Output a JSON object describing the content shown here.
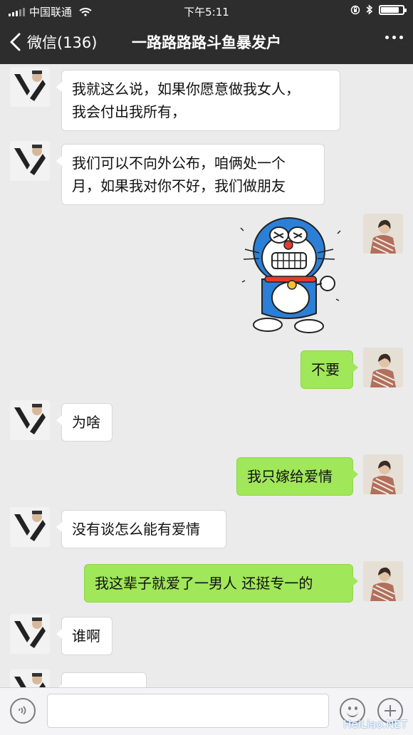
{
  "status_bar": {
    "carrier": "中国联通",
    "time": "下午5:11",
    "battery_level": 0.85
  },
  "nav": {
    "back_label": "微信(136)",
    "title": "一路路路路斗鱼暴发户"
  },
  "messages": [
    {
      "side": "left",
      "lines": [
        "我就这么说，如果你愿意做我女人，",
        "我会付出我所有，"
      ]
    },
    {
      "side": "left",
      "lines": [
        "我们可以不向外公布，咱俩处一个",
        "月，如果我对你不好，我们做朋友"
      ]
    },
    {
      "side": "right",
      "type": "sticker",
      "sticker": "doraemon-sticker"
    },
    {
      "side": "right",
      "lines": [
        "不要"
      ]
    },
    {
      "side": "left",
      "lines": [
        "为啥"
      ]
    },
    {
      "side": "right",
      "lines": [
        "我只嫁给爱情"
      ]
    },
    {
      "side": "left",
      "lines": [
        "没有谈怎么能有爱情"
      ]
    },
    {
      "side": "right",
      "lines": [
        "我这辈子就爱了一男人 还挺专一的"
      ]
    },
    {
      "side": "left",
      "lines": [
        "谁啊"
      ]
    }
  ],
  "input": {
    "value": "",
    "placeholder": ""
  },
  "icons": {
    "voice": "voice-icon",
    "emoji": "emoji-icon",
    "plus": "plus-icon",
    "back": "chevron-left-icon",
    "more": "more-dots-icon"
  },
  "colors": {
    "bar": "#2d2d2d",
    "chat_bg": "#ebebeb",
    "sent_bubble": "#a0e75a",
    "received_bubble": "#ffffff"
  },
  "watermark": "HeiLiao.NET"
}
